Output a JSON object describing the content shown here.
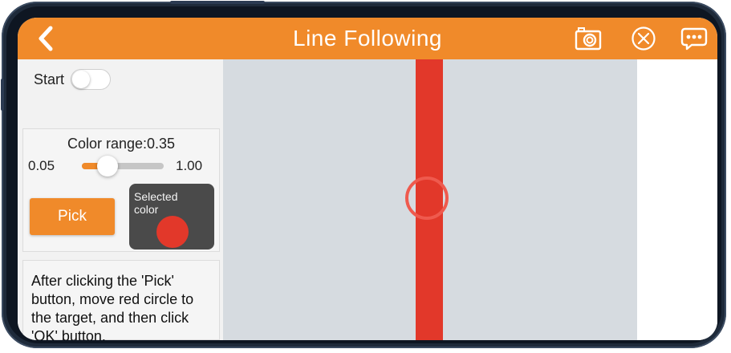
{
  "app": {
    "title": "Line Following"
  },
  "topbar": {
    "back_icon": "chevron-left-icon",
    "camera_icon": "camera-icon",
    "close_icon": "close-circle-icon",
    "chat_icon": "chat-bubble-icon"
  },
  "controls": {
    "start_label": "Start",
    "start_on": false,
    "color_range_label": "Color range:0.35",
    "color_range_value": 0.35,
    "range_min": "0.05",
    "range_max": "1.00",
    "pick_label": "Pick",
    "selected_color_label": "Selected color",
    "selected_color": "#e2382a"
  },
  "hint": {
    "text": "After clicking the 'Pick' button, move red circle to the target, and then click 'OK' button."
  },
  "colors": {
    "accent": "#f08a2a",
    "line_red": "#e2382a",
    "circle_red": "#ef5a4e",
    "view_bg": "#d6dbe0"
  }
}
